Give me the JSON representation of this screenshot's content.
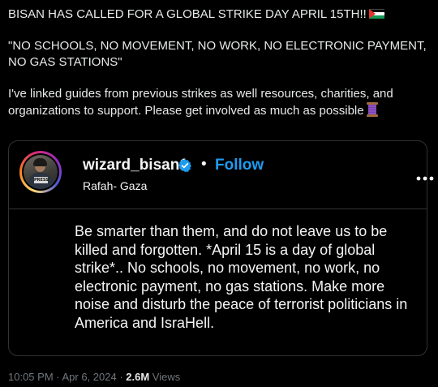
{
  "tweet": {
    "line1": "BISAN HAS CALLED FOR A GLOBAL STRIKE DAY APRIL 15TH!!",
    "line1_emoji": "palestine-flag-icon",
    "quote": "\"NO SCHOOLS, NO MOVEMENT, NO WORK, NO ELECTRONIC PAYMENT, NO GAS STATIONS\"",
    "body": "I've linked guides from previous strikes as well resources, charities, and organizations to support. Please get involved as much as possible",
    "body_emoji": "thread-spool-icon"
  },
  "embed": {
    "username": "wizard_bisan1",
    "verified_icon": "verified-badge-icon",
    "separator": "•",
    "follow_label": "Follow",
    "location": "Rafah- Gaza",
    "more_icon": "more-options-icon",
    "avatar_badge": "PRESS",
    "caption": "Be smarter than them, and do not leave us to be killed and forgotten. *April 15 is a day of global strike*.. No schools, no movement, no work, no electronic payment, no gas stations. Make more noise and disturb the peace of terrorist politicians in America and IsraHell."
  },
  "meta": {
    "time": "10:05 PM",
    "sep1": " · ",
    "date": "Apr 6, 2024",
    "sep2": " · ",
    "views_count": "2.6M",
    "views_label": " Views"
  },
  "colors": {
    "background": "#000000",
    "text": "#e7e9ea",
    "muted": "#71767b",
    "accent": "#1d9bf0",
    "border": "#2f3336"
  }
}
